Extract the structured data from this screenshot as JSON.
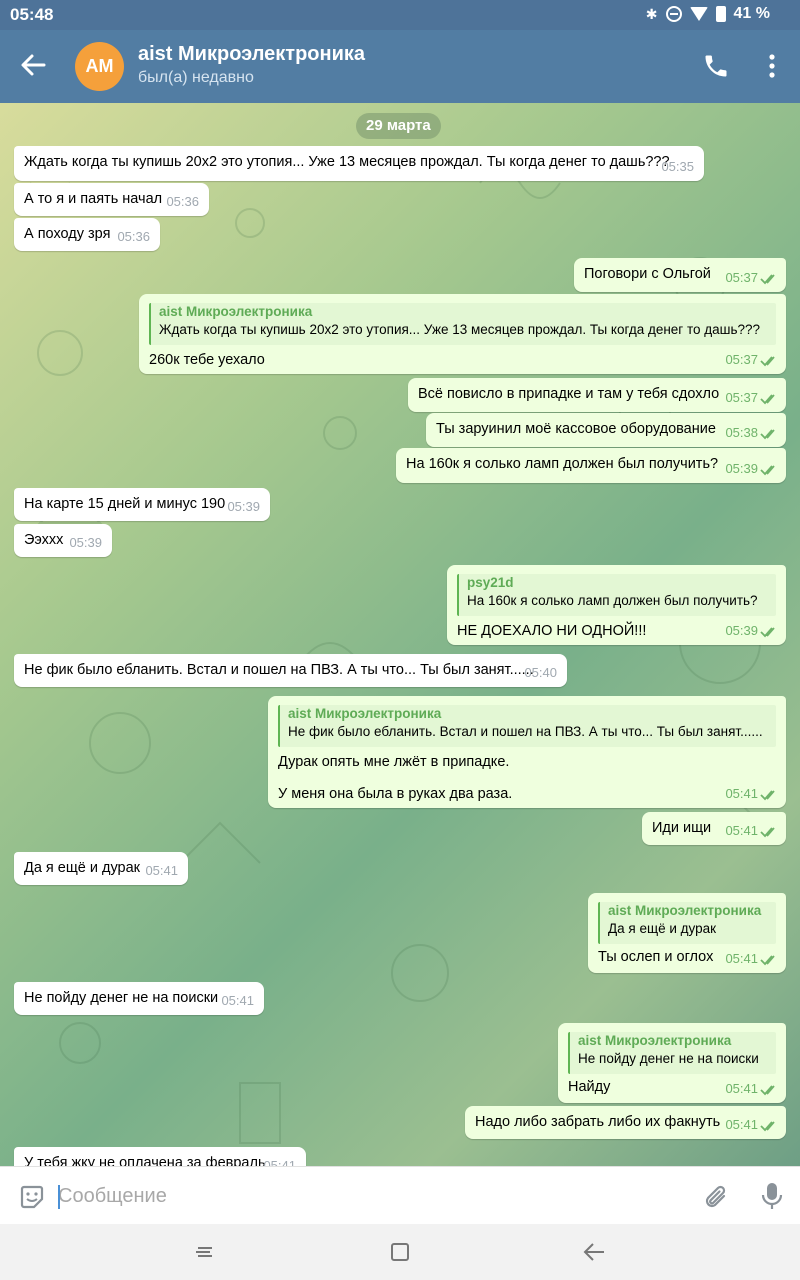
{
  "status_bar": {
    "time": "05:48",
    "battery": "41 %"
  },
  "header": {
    "avatar_initials": "AM",
    "title": "aist Микроэлектроника",
    "status": "был(а) недавно"
  },
  "date_separator": "29 марта",
  "messages": [
    {
      "dir": "in",
      "text": "Ждать когда ты купишь 20х2 это утопия... Уже 13 месяцев прождал. Ты когда денег то дашь???",
      "time": "05:35"
    },
    {
      "dir": "in",
      "text": "А то я и паять начал",
      "time": "05:36"
    },
    {
      "dir": "in",
      "text": "А походу зря",
      "time": "05:36"
    },
    {
      "dir": "out",
      "text": "Поговори с Ольгой",
      "time": "05:37"
    },
    {
      "dir": "out",
      "reply_name": "aist Микроэлектроника",
      "reply_text": "Ждать когда ты купишь 20х2 это утопия... Уже 13 месяцев прождал. Ты когда денег то дашь???",
      "text": "260к тебе уехало",
      "time": "05:37"
    },
    {
      "dir": "out",
      "text": "Всё повисло в припадке и там у тебя сдохло",
      "time": "05:37"
    },
    {
      "dir": "out",
      "text": "Ты заруинил моё кассовое оборудование",
      "time": "05:38"
    },
    {
      "dir": "out",
      "text": "На 160к я солько ламп должен был получить?",
      "time": "05:39"
    },
    {
      "dir": "in",
      "text": "На карте 15 дней и минус 190",
      "time": "05:39"
    },
    {
      "dir": "in",
      "text": "Ээххх",
      "time": "05:39"
    },
    {
      "dir": "out",
      "reply_name": "psy21d",
      "reply_text": "На 160к я солько ламп должен был получить?",
      "text": "НЕ ДОЕХАЛО НИ ОДНОЙ!!!",
      "time": "05:39"
    },
    {
      "dir": "in",
      "text": "Не фик было ебланить. Встал и пошел на ПВЗ. А ты что... Ты был занят......",
      "time": "05:40"
    },
    {
      "dir": "out",
      "reply_name": "aist Микроэлектроника",
      "reply_text": "Не фик было ебланить. Встал и пошел на ПВЗ. А ты что... Ты был занят......",
      "text": "Дурак опять мне лжёт в припадке.",
      "text2": "У меня она была в руках два раза.",
      "time": "05:41"
    },
    {
      "dir": "out",
      "text": "Иди ищи",
      "time": "05:41"
    },
    {
      "dir": "in",
      "text": "Да я ещё и дурак",
      "time": "05:41"
    },
    {
      "dir": "out",
      "reply_name": "aist Микроэлектроника",
      "reply_text": "Да я ещё и дурак",
      "text": "Ты ослеп и оглох",
      "time": "05:41"
    },
    {
      "dir": "in",
      "text": "Не пойду денег не на поиски",
      "time": "05:41"
    },
    {
      "dir": "out",
      "reply_name": "aist Микроэлектроника",
      "reply_text": "Не пойду денег не на поиски",
      "text": "Найду",
      "time": "05:41"
    },
    {
      "dir": "out",
      "text": "Надо либо забрать либо их факнуть",
      "time": "05:41"
    },
    {
      "dir": "in",
      "text": "У тебя жку не оплачена за февраль",
      "time": "05:41"
    }
  ],
  "input": {
    "placeholder": "Сообщение"
  },
  "colors": {
    "header": "#527da3",
    "status_bar": "#4e7399",
    "avatar": "#f5a03b",
    "outgoing_bubble": "#efffde",
    "incoming_bubble": "#ffffff",
    "read_check": "#6fb36a"
  }
}
